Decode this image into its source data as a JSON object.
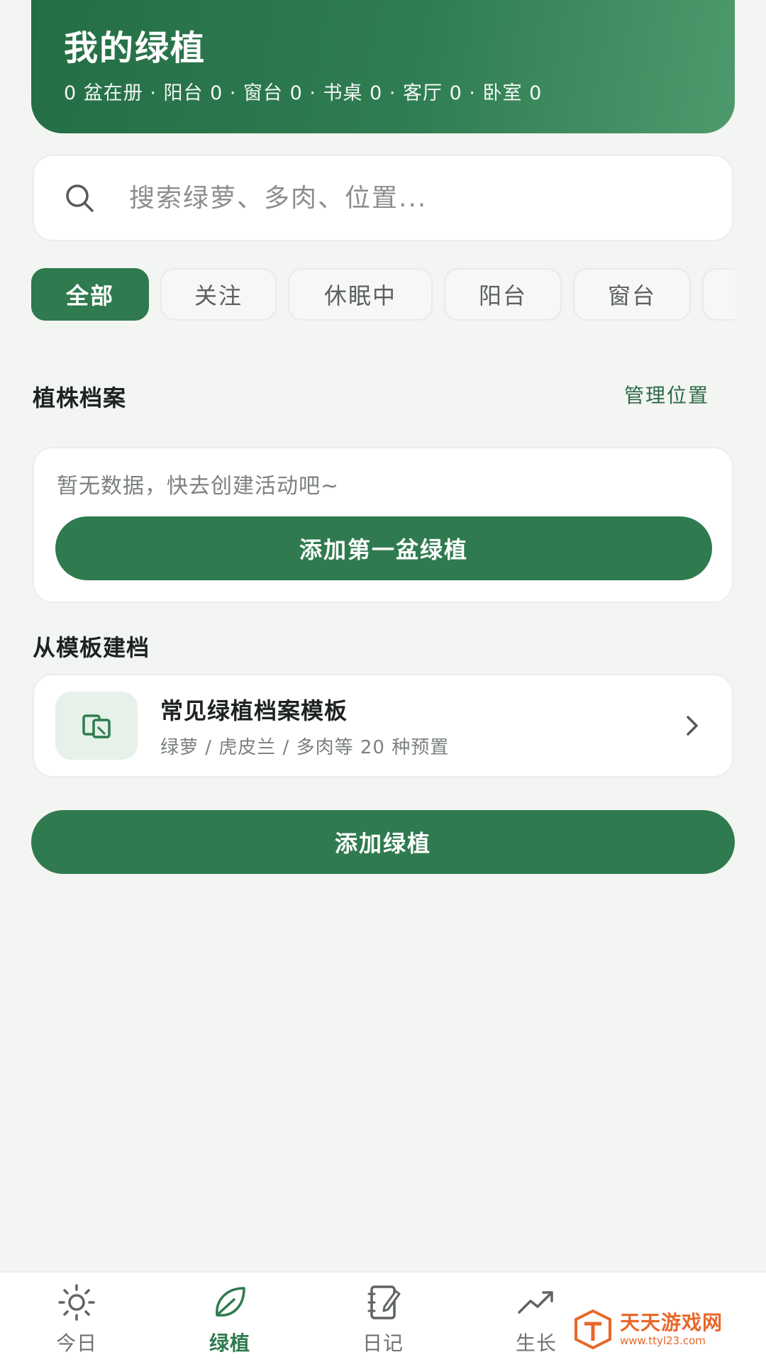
{
  "header": {
    "title": "我的绿植",
    "stats": "0 盆在册 · 阳台 0 · 窗台 0 · 书桌 0 · 客厅 0 · 卧室 0"
  },
  "search": {
    "placeholder": "搜索绿萝、多肉、位置..."
  },
  "chips": [
    {
      "label": "全部",
      "active": true
    },
    {
      "label": "关注",
      "active": false
    },
    {
      "label": "休眠中",
      "active": false
    },
    {
      "label": "阳台",
      "active": false
    },
    {
      "label": "窗台",
      "active": false
    }
  ],
  "plants_section": {
    "title": "植株档案",
    "manage_label": "管理位置",
    "empty_text": "暂无数据，快去创建活动吧~",
    "empty_button": "添加第一盆绿植"
  },
  "template_section": {
    "title": "从模板建档",
    "card_title": "常见绿植档案模板",
    "card_subtitle": "绿萝 / 虎皮兰 / 多肉等 20 种预置"
  },
  "add_button": "添加绿植",
  "nav": {
    "items": [
      {
        "label": "今日",
        "icon": "sun-icon",
        "active": false
      },
      {
        "label": "绿植",
        "icon": "leaf-icon",
        "active": true
      },
      {
        "label": "日记",
        "icon": "notebook-icon",
        "active": false
      },
      {
        "label": "生长",
        "icon": "trend-icon",
        "active": false
      }
    ]
  },
  "watermark": {
    "text": "天天游戏网",
    "sub": "www.ttyl23.com"
  },
  "colors": {
    "primary": "#2f7a4e",
    "header_start": "#256e45",
    "header_end": "#4e9a6d",
    "background": "#f3f5f2",
    "watermark": "#e8672a"
  }
}
